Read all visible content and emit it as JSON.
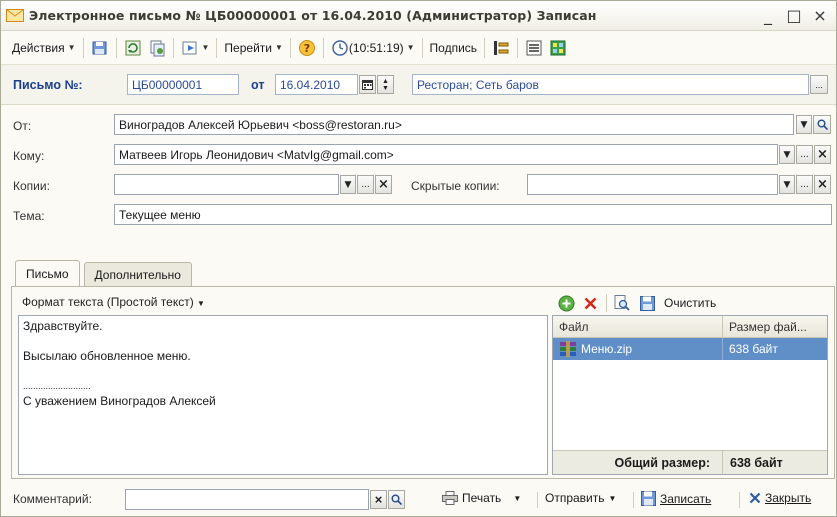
{
  "window": {
    "title": "Электронное письмо № ЦБ00000001 от 16.04.2010 (Администратор) Записан",
    "minimize": "_",
    "maximize": "□",
    "close": "×"
  },
  "toolbar": {
    "actions": "Действия",
    "goto": "Перейти",
    "time": "(10:51:19)",
    "signature": "Подпись"
  },
  "header": {
    "letter_label": "Письмо №:",
    "number": "ЦБ00000001",
    "from_label": "от",
    "date": "16.04.2010",
    "folder": "Ресторан; Сеть баров",
    "ellipsis": "..."
  },
  "fields": {
    "from_label": "От:",
    "from_value": "Виноградов Алексей Юрьевич <boss@restoran.ru>",
    "to_label": "Кому:",
    "to_value": "Матвеев Игорь Леонидович <MatvIg@gmail.com>",
    "cc_label": "Копии:",
    "cc_value": "",
    "bcc_label": "Скрытые копии:",
    "bcc_value": "",
    "subject_label": "Тема:",
    "subject_value": "Текущее меню"
  },
  "tabs": [
    "Письмо",
    "Дополнительно"
  ],
  "message": {
    "format": "Формат текста (Простой текст)",
    "lines": [
      "Здравствуйте.",
      "",
      "Высылаю обновленное меню.",
      "",
      "...........................",
      "С уважением Виноградов Алексей"
    ]
  },
  "attachments": {
    "clear": "Очистить",
    "col_file": "Файл",
    "col_size": "Размер фай...",
    "rows": [
      {
        "name": "Меню.zip",
        "size": "638 байт"
      }
    ],
    "total_label": "Общий размер:",
    "total_value": "638 байт"
  },
  "bottom": {
    "comment_label": "Комментарий:",
    "comment_value": "",
    "print": "Печать",
    "send": "Отправить",
    "save": "Записать",
    "close": "Закрыть"
  }
}
